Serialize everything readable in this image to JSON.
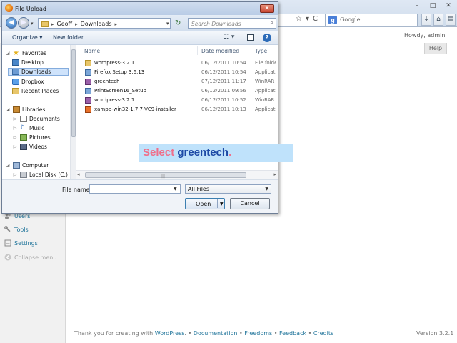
{
  "browser": {
    "window_buttons": [
      "–",
      "□",
      "✕"
    ],
    "search_engine_placeholder": "Google",
    "nav_icons": [
      "☆",
      "▾",
      "C"
    ],
    "right_buttons": [
      "↓",
      "⌂",
      "▤"
    ]
  },
  "wp": {
    "howdy": "Howdy, admin",
    "help_tab": "Help",
    "sidebar": {
      "users": "Users",
      "tools": "Tools",
      "settings": "Settings",
      "collapse": "Collapse menu"
    },
    "footer": {
      "thank_you": "Thank you for creating with ",
      "wordpress": "WordPress",
      "sep1": ". • ",
      "documentation": "Documentation",
      "sep2": " • ",
      "freedoms": "Freedoms",
      "sep3": " • ",
      "feedback": "Feedback",
      "sep4": " • ",
      "credits": "Credits"
    },
    "version": "Version 3.2.1"
  },
  "dialog": {
    "title": "File Upload",
    "close": "✕",
    "breadcrumb": [
      "Geoff",
      "Downloads"
    ],
    "search_placeholder": "Search Downloads",
    "toolbar": {
      "organize": "Organize ▾",
      "new_folder": "New folder",
      "view": "☷ ▾",
      "help": "?"
    },
    "nav_tree": [
      {
        "label": "Favorites",
        "icon": "star-icon"
      },
      {
        "label": "Desktop",
        "icon": "desktop-icon"
      },
      {
        "label": "Downloads",
        "icon": "downloads-icon"
      },
      {
        "label": "Dropbox",
        "icon": "dropbox-icon"
      },
      {
        "label": "Recent Places",
        "icon": "recent-places-icon"
      },
      {
        "label": "Libraries",
        "icon": "libraries-icon"
      },
      {
        "label": "Documents",
        "icon": "documents-icon"
      },
      {
        "label": "Music",
        "icon": "music-icon"
      },
      {
        "label": "Pictures",
        "icon": "pictures-icon"
      },
      {
        "label": "Videos",
        "icon": "videos-icon"
      },
      {
        "label": "Computer",
        "icon": "computer-icon"
      },
      {
        "label": "Local Disk (C:)",
        "icon": "disk-icon"
      }
    ],
    "columns": {
      "name": "Name",
      "date": "Date modified",
      "type": "Type"
    },
    "files": [
      {
        "name": "wordpress-3.2.1",
        "date": "06/12/2011 10:54",
        "type": "File folder",
        "icon": "folder"
      },
      {
        "name": "Firefox Setup 3.6.13",
        "date": "06/12/2011 10:54",
        "type": "Application",
        "icon": "app"
      },
      {
        "name": "greentech",
        "date": "07/12/2011 11:17",
        "type": "WinRAR ZIP",
        "icon": "rar"
      },
      {
        "name": "PrintScreen16_Setup",
        "date": "06/12/2011 09:56",
        "type": "Application",
        "icon": "app"
      },
      {
        "name": "wordpress-3.2.1",
        "date": "06/12/2011 10:52",
        "type": "WinRAR ZIP",
        "icon": "rar"
      },
      {
        "name": "xampp-win32-1.7.7-VC9-installer",
        "date": "06/12/2011 10:13",
        "type": "Application",
        "icon": "xampp"
      }
    ],
    "file_name_label": "File name:",
    "file_name_value": "",
    "filter": "All Files",
    "open": "Open",
    "cancel": "Cancel"
  },
  "caption": {
    "word1": "Select",
    "word2": "greentech",
    "dot": "."
  }
}
